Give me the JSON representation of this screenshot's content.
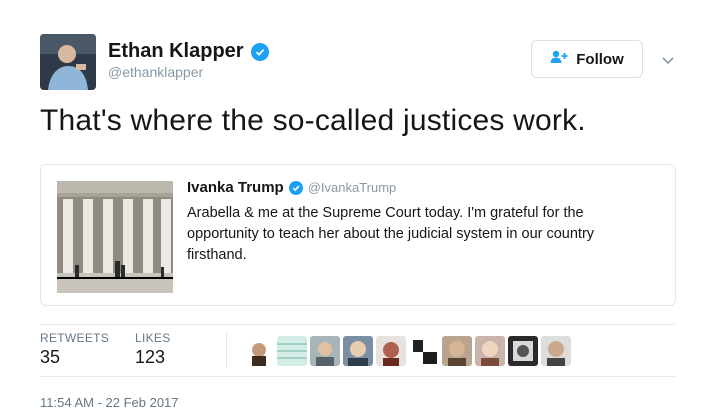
{
  "author": {
    "name": "Ethan Klapper",
    "handle": "@ethanklapper",
    "verified": true
  },
  "follow_button": {
    "label": "Follow",
    "icon": "add-user-icon"
  },
  "tweet_text": "That's where the so-called justices work.",
  "quoted_tweet": {
    "name": "Ivanka Trump",
    "handle": "@IvankaTrump",
    "verified": true,
    "text": "Arabella & me at the Supreme Court today. I'm grateful for the opportunity to teach her about the judicial system in our country firsthand."
  },
  "stats": {
    "retweets_label": "RETWEETS",
    "retweets_value": "35",
    "likes_label": "LIKES",
    "likes_value": "123",
    "liker_avatar_count": 10
  },
  "timestamp": "11:54 AM - 22 Feb 2017",
  "colors": {
    "verified": "#1da1f2",
    "text": "#14171a",
    "muted": "#657786"
  }
}
